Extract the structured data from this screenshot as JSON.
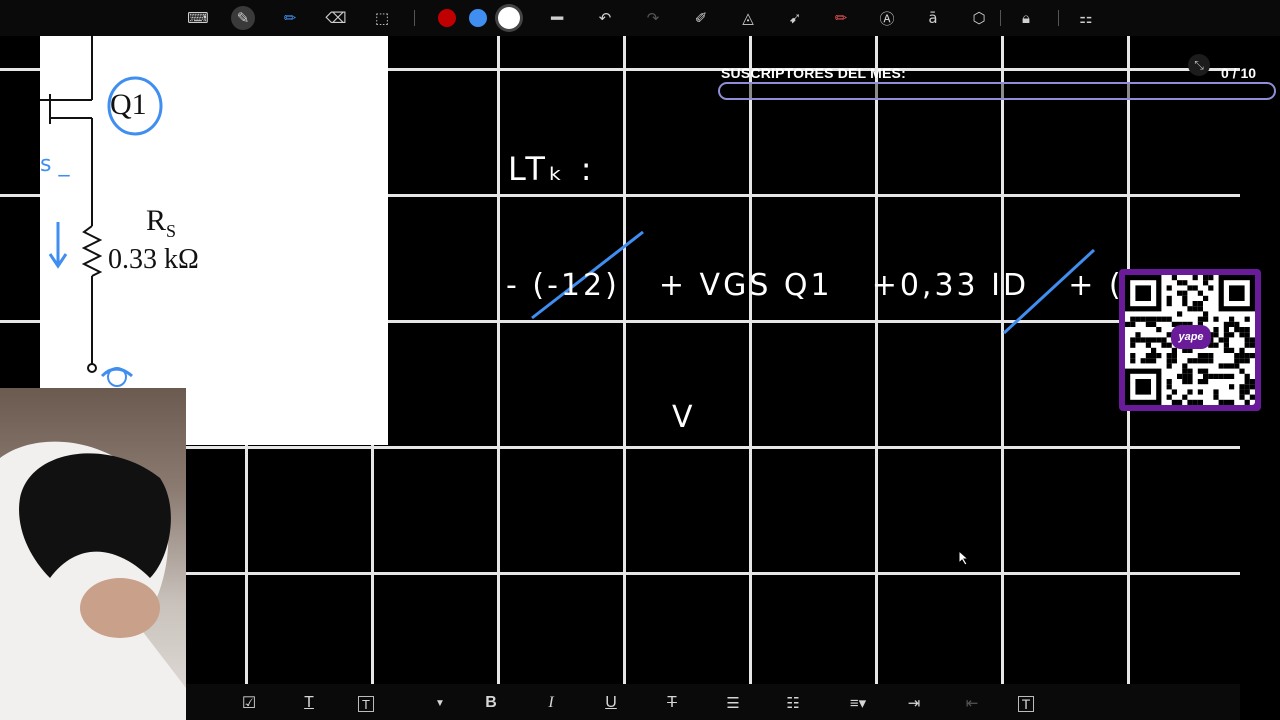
{
  "toolbar": {
    "tools": [
      "keyboard-icon",
      "pen-icon",
      "highlighter-icon",
      "eraser-icon",
      "lasso-select-icon"
    ],
    "colors": {
      "red": "#c00000",
      "blue": "#3f8ef0",
      "white": "#ffffff"
    },
    "actions": [
      "line-width-icon",
      "undo-icon",
      "redo-icon",
      "shape-pen-icon",
      "ruler-icon",
      "arrow-icon",
      "marker-icon",
      "text-a-icon",
      "text-recognize-icon",
      "shapes-icon",
      "lock-icon",
      "grid-apps-icon"
    ]
  },
  "circuit_image": {
    "transistor_label": "Q1",
    "resistor_name": "R",
    "resistor_subscript": "S",
    "resistor_value": "0.33 kΩ",
    "left_fragment": "s _"
  },
  "whiteboard": {
    "law_label": "LTₖ :",
    "equation_terms": [
      "- (-12)",
      "+ VGS Q1",
      "+0,33 ID",
      "+ (-12)",
      "="
    ],
    "partial_line": "V",
    "ink_color": "#ffffff",
    "accent_color": "#3f8ef0"
  },
  "subscribers": {
    "title": "SUSCRIPTORES DEL MES:",
    "count": "0 / 10",
    "progress": 0.0,
    "bar_color": "#8f8fd6"
  },
  "qr": {
    "brand_label": "yape",
    "frame_color": "#6a1b9a"
  },
  "bottom_toolbar": {
    "items": [
      "checkbox-icon",
      "text-icon",
      "text-box-icon",
      "dropdown-icon",
      "bold-icon",
      "italic-icon",
      "underline-icon",
      "strikethrough-icon",
      "numbered-list-icon",
      "bullet-list-icon",
      "align-icon",
      "indent-icon",
      "outdent-icon",
      "text-frame-icon"
    ]
  }
}
